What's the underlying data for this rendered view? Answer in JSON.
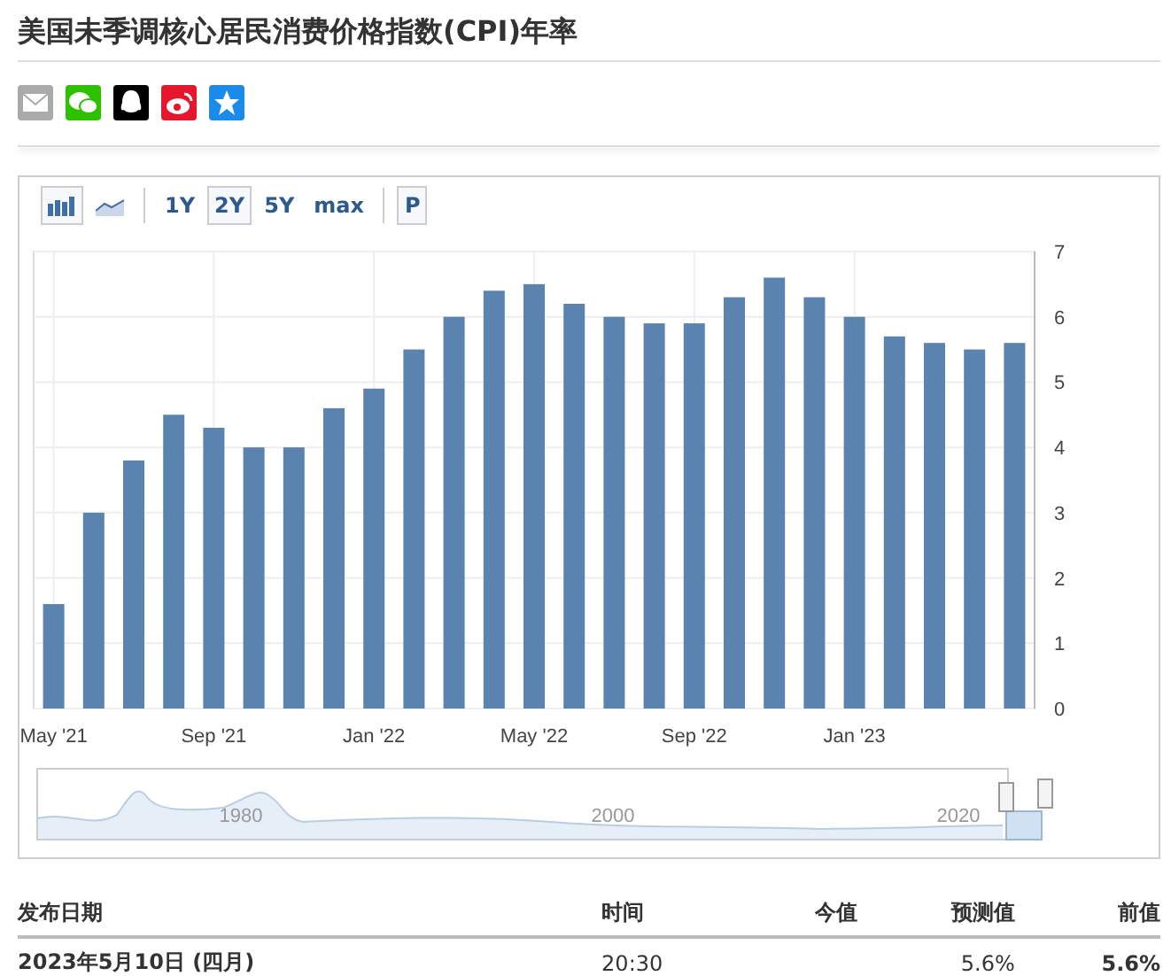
{
  "title": "美国未季调核心居民消费价格指数(CPI)年率",
  "share_icons": [
    {
      "kind": "mail"
    },
    {
      "kind": "wechat"
    },
    {
      "kind": "qq"
    },
    {
      "kind": "weibo"
    },
    {
      "kind": "star"
    }
  ],
  "toolbar": {
    "chart_types": [
      {
        "kind": "bar",
        "selected": true
      },
      {
        "kind": "line",
        "selected": false
      }
    ],
    "ranges": [
      {
        "label": "1Y",
        "selected": false
      },
      {
        "label": "2Y",
        "selected": true
      },
      {
        "label": "5Y",
        "selected": false
      },
      {
        "label": "max",
        "selected": false
      }
    ],
    "p_button": "P"
  },
  "chart": {
    "chart_data": {
      "type": "bar",
      "grid": true,
      "categories": [
        "May '21",
        null,
        null,
        null,
        "Sep '21",
        null,
        null,
        null,
        "Jan '22",
        null,
        null,
        null,
        "May '22",
        null,
        null,
        null,
        "Sep '22",
        null,
        null,
        null,
        "Jan '23",
        null,
        null,
        null,
        null
      ],
      "series": [
        {
          "color": "#5b83b0",
          "values": [
            1.6,
            3.0,
            3.8,
            4.5,
            4.3,
            4.0,
            4.0,
            4.6,
            4.9,
            5.5,
            6.0,
            6.4,
            6.5,
            6.2,
            6.0,
            5.9,
            5.9,
            6.3,
            6.6,
            6.3,
            6.0,
            5.7,
            5.6,
            5.5,
            5.6
          ]
        }
      ],
      "ylim": [
        0,
        7
      ],
      "yticks": [
        0,
        1,
        2,
        3,
        4,
        5,
        6,
        7
      ]
    }
  },
  "navigator": {
    "labels": [
      "1980",
      "2000",
      "2020"
    ]
  },
  "table": {
    "columns": [
      "发布日期",
      "时间",
      "今值",
      "预测值",
      "前值"
    ],
    "rows": [
      [
        "2023年5月10日 (四月)",
        "20:30",
        "",
        "5.6%",
        "5.6%"
      ]
    ]
  }
}
